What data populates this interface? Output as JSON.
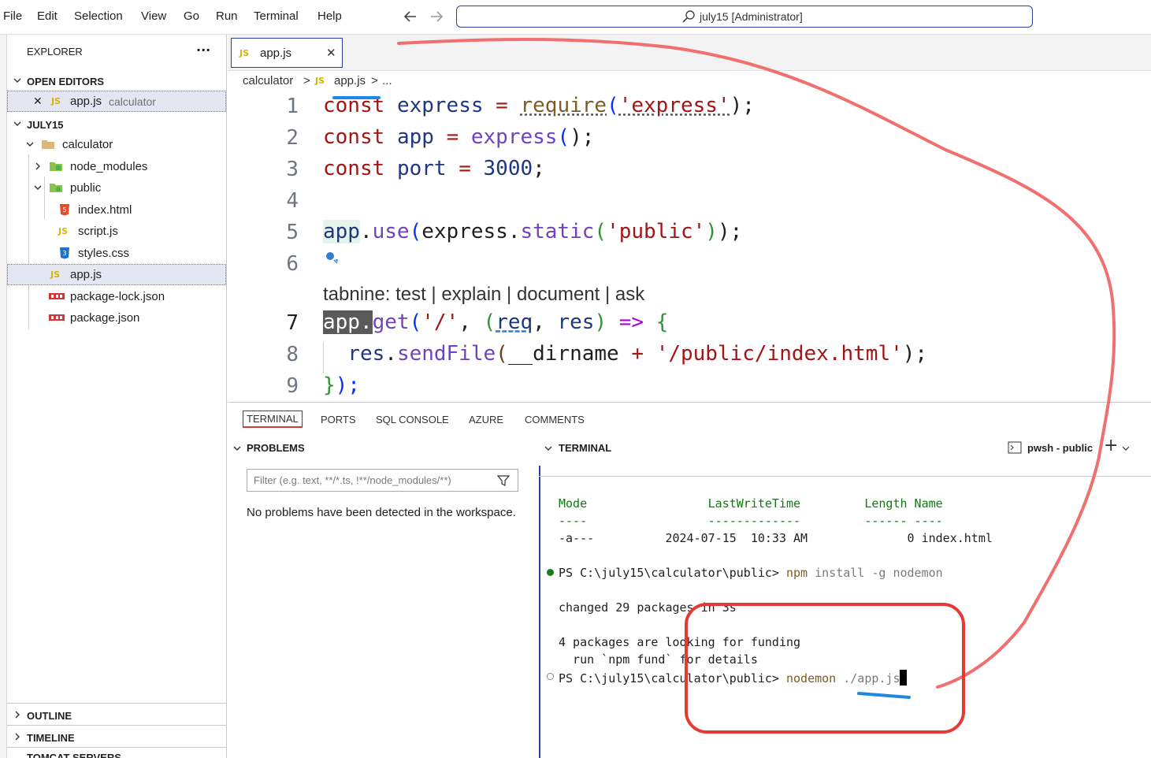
{
  "menu": {
    "items": [
      "File",
      "Edit",
      "Selection",
      "View",
      "Go",
      "Run",
      "Terminal",
      "Help"
    ],
    "search_text": "july15 [Administrator]"
  },
  "explorer": {
    "title": "EXPLORER",
    "more": "···",
    "open_editors_header": "OPEN EDITORS",
    "open_editor": {
      "close": "✕",
      "icon": "JS",
      "name": "app.js",
      "folder": "calculator"
    },
    "workspace_header": "JULY15",
    "tree": [
      {
        "name": "calculator",
        "kind": "folder"
      },
      {
        "name": "node_modules",
        "kind": "folder"
      },
      {
        "name": "public",
        "kind": "folder"
      },
      {
        "name": "index.html",
        "kind": "html"
      },
      {
        "name": "script.js",
        "kind": "js"
      },
      {
        "name": "styles.css",
        "kind": "css"
      },
      {
        "name": "app.js",
        "kind": "js"
      },
      {
        "name": "package-lock.json",
        "kind": "npm"
      },
      {
        "name": "package.json",
        "kind": "npm"
      }
    ],
    "outline_header": "OUTLINE",
    "timeline_header": "TIMELINE",
    "tomcat_header": "TOMCAT SERVERS"
  },
  "editor": {
    "tab_label": "app.js",
    "tab_icon": "JS",
    "tab_close": "✕",
    "breadcrumb": {
      "folder": "calculator",
      "sep": ">",
      "icon": "JS",
      "file": "app.js",
      "more": "..."
    },
    "line_numbers": [
      "1",
      "2",
      "3",
      "4",
      "5",
      "6",
      "7",
      "8",
      "9"
    ],
    "codelens": "tabnine: test | explain | document | ask",
    "code": {
      "l1": {
        "kw": "const",
        "var": "express",
        "op": "=",
        "fn": "require",
        "open": "(",
        "str": "'express'",
        "close": ");"
      },
      "l2": {
        "kw": "const",
        "var": "app",
        "op": "=",
        "fn": "express",
        "open": "(",
        "close": ");"
      },
      "l3": {
        "kw": "const",
        "var": "port",
        "op": "=",
        "num": "3000",
        "close": ";"
      },
      "l5": {
        "obj": "app",
        "dot": ".",
        "fn": "use",
        "open": "(",
        "obj2": "express",
        "dot2": ".",
        "fn2": "static",
        "open2": "(",
        "str": "'public'",
        "close2": ")",
        "close": ");"
      },
      "l7": {
        "obj": "app.",
        "fn": "get",
        "open": "(",
        "str": "'/'",
        "comma": ",",
        "open2": "(",
        "p1": "req",
        "comma2": ",",
        "p2": "res",
        "close2": ")",
        "arrow": "=>",
        "brace": "{"
      },
      "l8": {
        "obj": "res",
        "dot": ".",
        "fn": "sendFile",
        "open": "(",
        "var": "__dirname",
        "op": "+",
        "str": "'/public/index.html'",
        "close": ");"
      },
      "l9": {
        "brace": "}",
        "close": ");"
      }
    }
  },
  "panel": {
    "tabs": [
      "TERMINAL",
      "PORTS",
      "SQL CONSOLE",
      "AZURE",
      "COMMENTS"
    ],
    "problems_header": "PROBLEMS",
    "filter_placeholder": "Filter (e.g. text, **/*.ts, !**/node_modules/**)",
    "no_problems": "No problems have been detected in the workspace.",
    "terminal_header": "TERMINAL",
    "terminal_instance": "pwsh - public",
    "terminal_add": "+",
    "terminal_lines": {
      "hdr": "Mode                 LastWriteTime         Length Name",
      "dash": "----                 -------------         ------ ----",
      "row": "-a---          2024-07-15  10:33 AM              0 index.html",
      "prompt1": "PS C:\\july15\\calculator\\public> ",
      "cmd1": "npm",
      "args1": " install -g nodemon",
      "changed": "changed 29 packages in 3s",
      "funding1": "4 packages are looking for funding",
      "funding2": "  run `npm fund` for details",
      "prompt2": "PS C:\\july15\\calculator\\public> ",
      "cmd2": "nodemon",
      "args2": " ./app.js"
    }
  },
  "colors": {
    "accent": "#2b3f9c",
    "annotation_red": "#e53935",
    "annotation_pink": "#f07070",
    "annotation_blue": "#1e88e5"
  }
}
